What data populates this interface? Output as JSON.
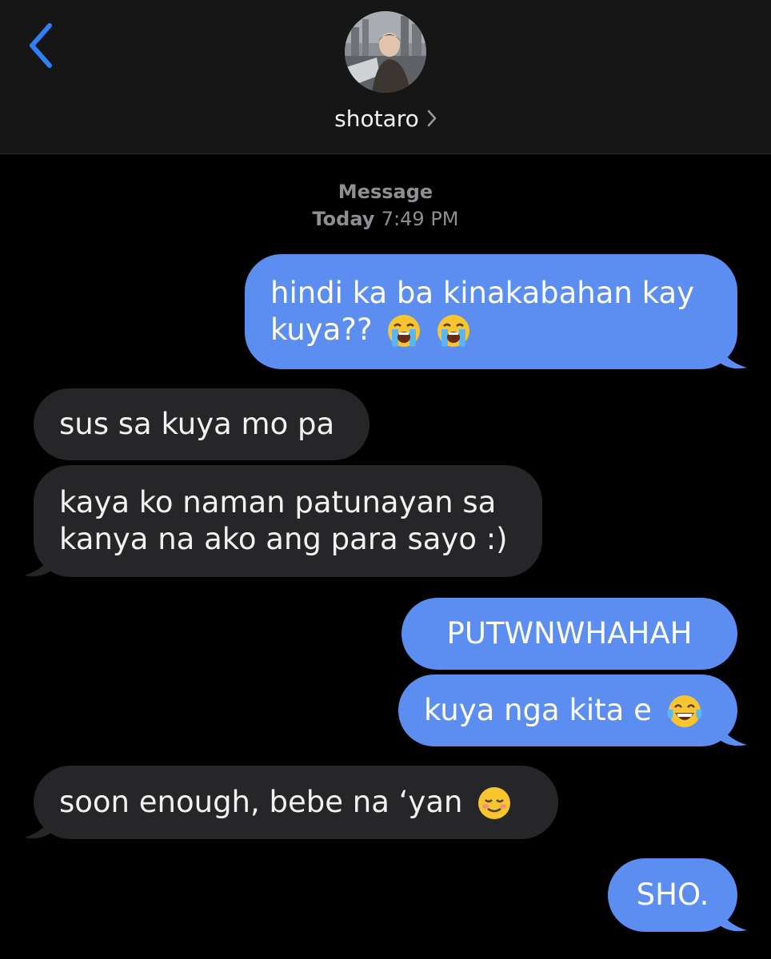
{
  "header": {
    "contact_name": "shotaro"
  },
  "thread": {
    "service_label": "Message",
    "date_label": "Today",
    "time_label": "7:49 PM"
  },
  "messages": [
    {
      "direction": "outgoing",
      "lines": [
        "hindi ka ba kinakabahan kay",
        "kuya??"
      ],
      "emojis": [
        "loudly-crying-face",
        "loudly-crying-face"
      ]
    },
    {
      "direction": "incoming",
      "lines": [
        "sus sa kuya mo pa"
      ]
    },
    {
      "direction": "incoming",
      "lines": [
        "kaya ko naman patunayan sa",
        "kanya na ako ang para sayo :)"
      ]
    },
    {
      "direction": "outgoing",
      "lines": [
        "PUTWNWHAHAH"
      ]
    },
    {
      "direction": "outgoing",
      "lines": [
        "kuya nga kita e"
      ],
      "emojis": [
        "face-with-tears-of-joy"
      ]
    },
    {
      "direction": "incoming",
      "lines": [
        "soon enough, bebe na ‘yan"
      ],
      "emojis": [
        "smiling-face"
      ]
    },
    {
      "direction": "outgoing",
      "lines": [
        "SHO."
      ]
    }
  ],
  "colors": {
    "outgoing_bubble": "#5b8ef0",
    "incoming_bubble": "#262628",
    "accent": "#2f7ff6",
    "header_bg": "#161616"
  },
  "icons": [
    "chevron-left-icon",
    "chevron-right-icon",
    "avatar"
  ]
}
